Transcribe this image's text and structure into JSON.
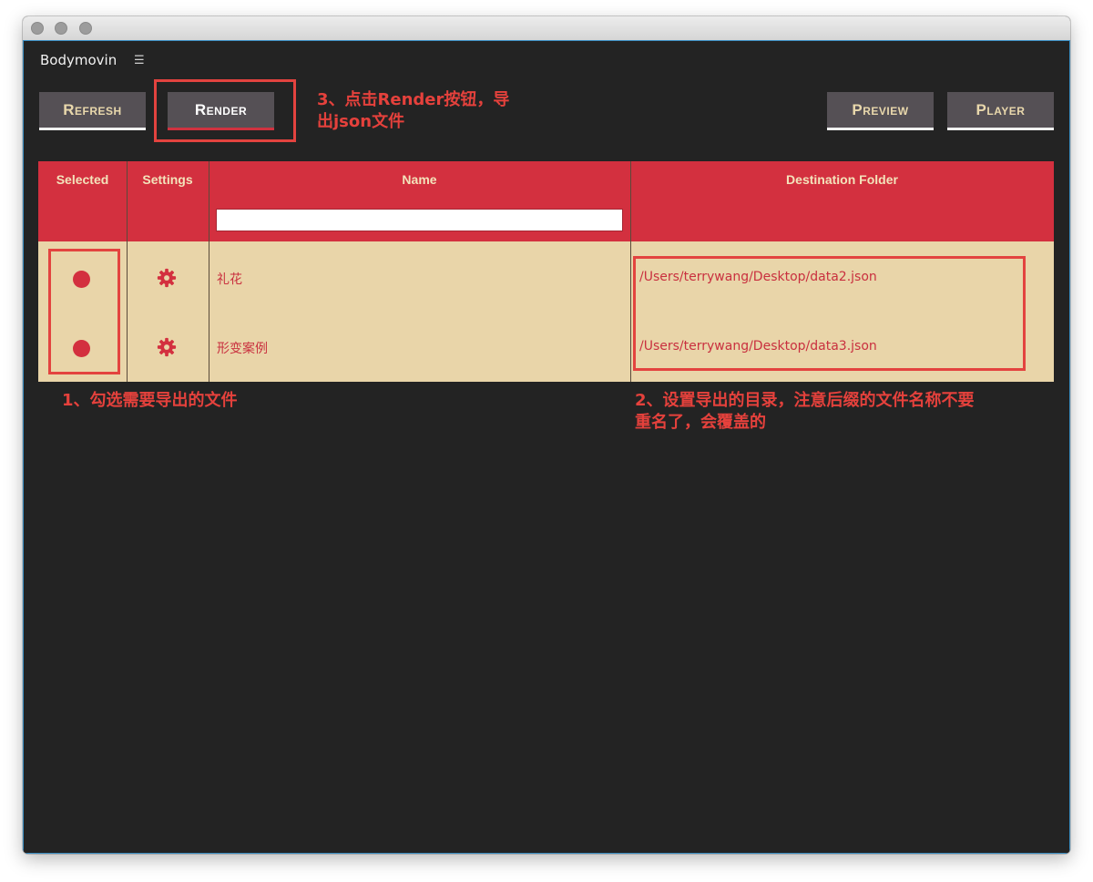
{
  "panel": {
    "title": "Bodymovin",
    "menu_glyph": "☰"
  },
  "toolbar": {
    "refresh_label": "Refresh",
    "render_label": "Render",
    "preview_label": "Preview",
    "player_label": "Player"
  },
  "table": {
    "headers": {
      "selected": "Selected",
      "settings": "Settings",
      "name": "Name",
      "destination": "Destination Folder"
    },
    "name_filter_value": "",
    "rows": [
      {
        "selected": true,
        "name": "礼花",
        "destination": "/Users/terrywang/Desktop/data2.json"
      },
      {
        "selected": true,
        "name": "形变案例",
        "destination": "/Users/terrywang/Desktop/data3.json"
      }
    ]
  },
  "annotations": {
    "render_note_line1": "3、点击Render按钮，导",
    "render_note_line2": "出json文件",
    "select_note": "1、勾选需要导出的文件",
    "dest_note_line1": "2、设置导出的目录，注意后缀的文件名称不要",
    "dest_note_line2": "重名了，会覆盖的"
  },
  "colors": {
    "accent_red": "#d3303f",
    "row_bg": "#e9d5a9",
    "panel_bg": "#232323",
    "annotation_red": "#e5413c"
  },
  "icons": {
    "row_settings": "gear-icon",
    "row_selected": "radio-dot-icon"
  }
}
